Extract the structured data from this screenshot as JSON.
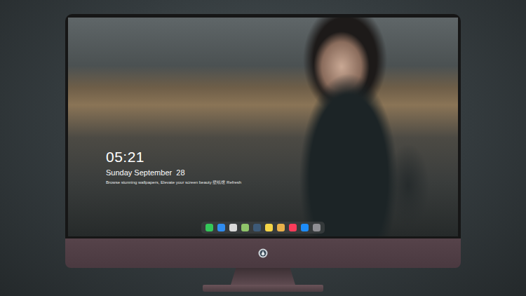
{
  "monitor": {
    "screen": {
      "wallpaper": {
        "kind": "photo"
      },
      "clock": {
        "time": "05:21",
        "date": "Sunday September  28"
      },
      "tagline": "Browse stunning wallpapers, Elevate your screen beauty 壁纸馆 Refresh",
      "dock": [
        {
          "color": "#34c759"
        },
        {
          "color": "#2f8cf0"
        },
        {
          "color": "#d9d9d9"
        },
        {
          "color": "#8fc46a"
        },
        {
          "color": "#3d5a78"
        },
        {
          "color": "#f5d547"
        },
        {
          "color": "#e8b04a"
        },
        {
          "color": "#fa3c5a"
        },
        {
          "color": "#1d8cf8"
        },
        {
          "color": "#8e8e93"
        }
      ]
    }
  }
}
